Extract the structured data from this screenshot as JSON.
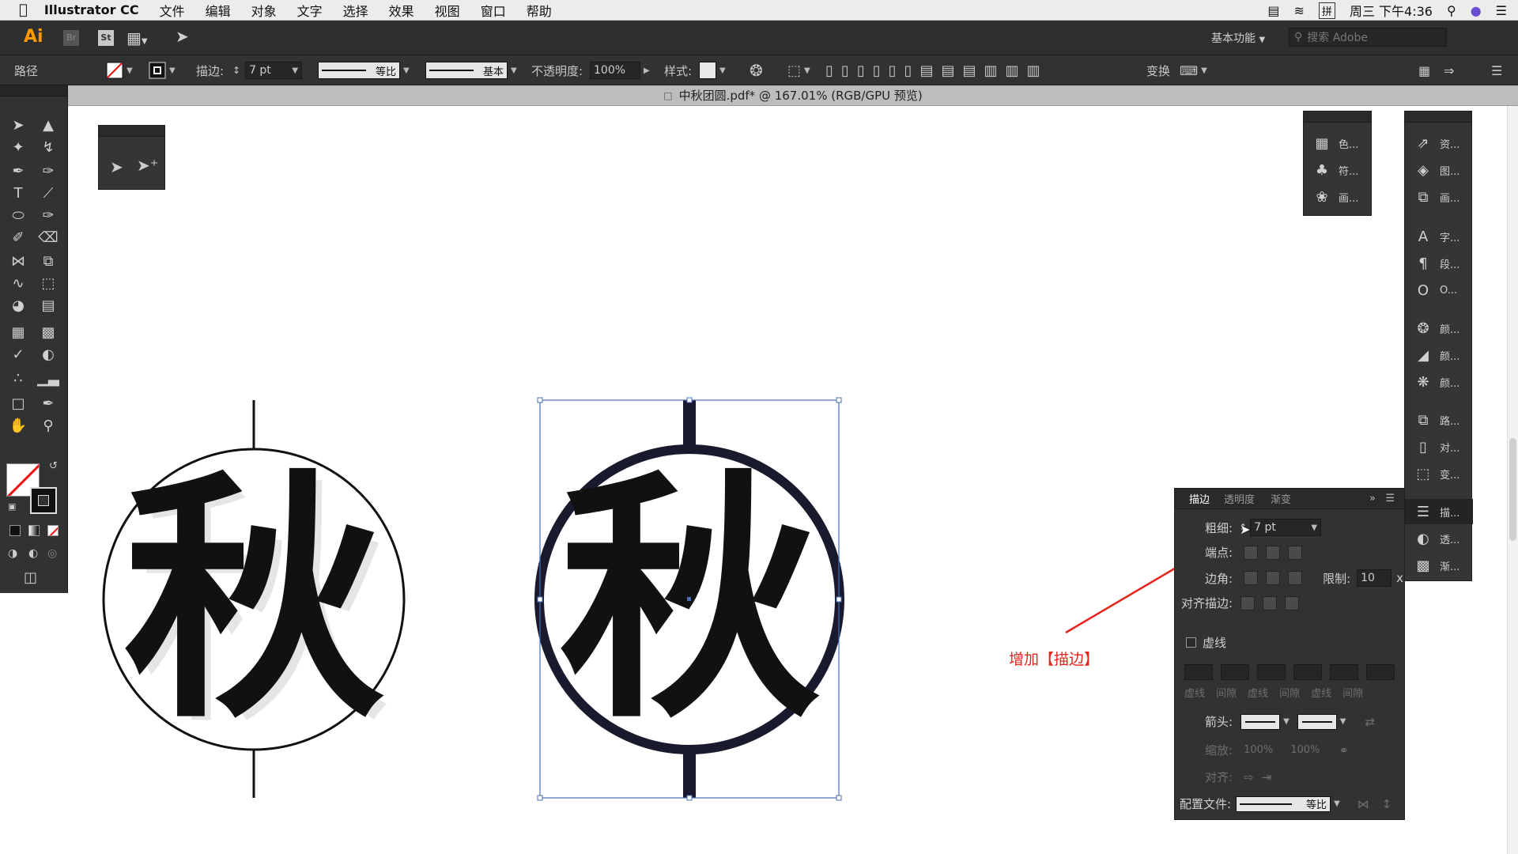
{
  "menubar": {
    "app_name": "Illustrator CC",
    "items": [
      "文件",
      "编辑",
      "对象",
      "文字",
      "选择",
      "效果",
      "视图",
      "窗口",
      "帮助"
    ],
    "clock": "周三 下午4:36"
  },
  "appbar": {
    "logo": "Ai",
    "bridge": "Br",
    "stock": "St",
    "workspace": "基本功能",
    "search_placeholder": "搜索 Adobe"
  },
  "control": {
    "object_type": "路径",
    "stroke_label": "描边:",
    "stroke_value": "7 pt",
    "profile1": "等比",
    "profile2": "基本",
    "opacity_label": "不透明度:",
    "opacity_value": "100%",
    "style_label": "样式:",
    "transform_label": "变换"
  },
  "document": {
    "tab_title": "中秋团圆.pdf* @ 167.01% (RGB/GPU 预览)"
  },
  "canvas": {
    "glyph": "秋",
    "annotation": "增加【描边】",
    "colors": {
      "annotation": "#e8231c",
      "selection": "#4a6fb5",
      "stroke": "#1a1a2e"
    }
  },
  "side_panel_a": {
    "items": [
      {
        "icon": "swatches-icon",
        "label": "色..."
      },
      {
        "icon": "symbols-icon",
        "label": "符..."
      },
      {
        "icon": "brushes-icon",
        "label": "画..."
      }
    ]
  },
  "side_panel_b": {
    "items": [
      {
        "icon": "asset-export-icon",
        "label": "资..."
      },
      {
        "icon": "layers-icon",
        "label": "图..."
      },
      {
        "icon": "artboards-icon",
        "label": "画..."
      },
      {
        "icon": "character-icon",
        "label": "字..."
      },
      {
        "icon": "paragraph-icon",
        "label": "段..."
      },
      {
        "icon": "opentype-icon",
        "label": "O..."
      },
      {
        "icon": "color-icon",
        "label": "颜..."
      },
      {
        "icon": "color-guide-icon",
        "label": "颜..."
      },
      {
        "icon": "color-themes-icon",
        "label": "颜..."
      },
      {
        "icon": "pathfinder-icon",
        "label": "路..."
      },
      {
        "icon": "align-icon",
        "label": "对..."
      },
      {
        "icon": "transform-icon",
        "label": "变..."
      },
      {
        "icon": "stroke-icon",
        "label": "描..."
      },
      {
        "icon": "transparency-icon",
        "label": "透..."
      },
      {
        "icon": "gradient-icon",
        "label": "渐..."
      }
    ]
  },
  "stroke_panel": {
    "tabs": [
      "描边",
      "透明度",
      "渐变"
    ],
    "weight_label": "粗细:",
    "weight_value": "7 pt",
    "cap_label": "端点:",
    "corner_label": "边角:",
    "limit_label": "限制:",
    "limit_value": "10",
    "limit_unit": "x",
    "align_label": "对齐描边:",
    "dashed_label": "虚线",
    "dash_headers": [
      "虚线",
      "间隙",
      "虚线",
      "间隙",
      "虚线",
      "间隙"
    ],
    "arrow_label": "箭头:",
    "scale_label": "缩放:",
    "scale_values": [
      "100%",
      "100%"
    ],
    "align2_label": "对齐:",
    "profile_label": "配置文件:",
    "profile_value": "等比"
  }
}
